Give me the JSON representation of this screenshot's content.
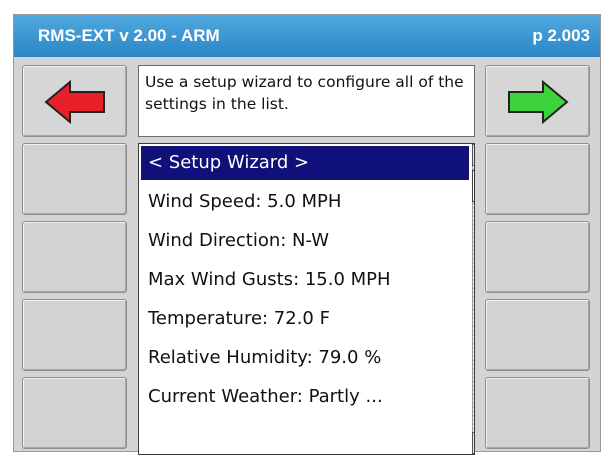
{
  "header": {
    "title": "RMS-EXT v 2.00 - ARM",
    "page": "p 2.003"
  },
  "description": "Use a setup wizard to configure all of the settings in the list.",
  "list": {
    "items": [
      "< Setup Wizard >",
      "Wind Speed: 5.0 MPH",
      "Wind Direction: N-W",
      "Max Wind Gusts: 15.0 MPH",
      "Temperature: 72.0 F",
      "Relative Humidity: 79.0 %",
      "Current Weather: Partly ..."
    ],
    "selected_index": 0
  },
  "icons": {
    "back": "left-arrow-icon",
    "forward": "right-arrow-icon",
    "back_color": "#e8202a",
    "forward_color": "#3dd33a"
  }
}
